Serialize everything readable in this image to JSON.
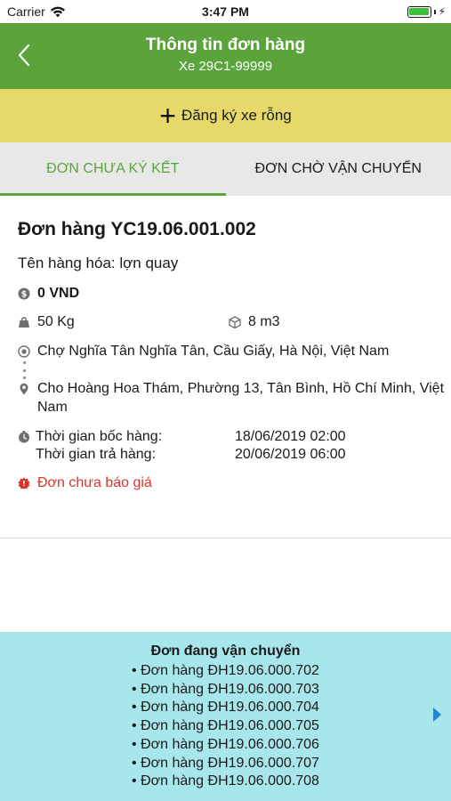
{
  "status_bar": {
    "carrier": "Carrier",
    "time": "3:47 PM"
  },
  "nav": {
    "title": "Thông tin đơn hàng",
    "subtitle": "Xe 29C1-99999"
  },
  "register": {
    "label": "Đăng ký xe rỗng"
  },
  "tabs": [
    {
      "label": "ĐƠN CHƯA KÝ KẾT",
      "active": true
    },
    {
      "label": "ĐƠN CHỜ VẬN CHUYỂN",
      "active": false
    }
  ],
  "order": {
    "title": "Đơn hàng YC19.06.001.002",
    "goods": "Tên hàng hóa: lợn quay",
    "price": "0 VND",
    "weight": "50 Kg",
    "volume": "8 m3",
    "pickup_address": "Chợ Nghĩa Tân Nghĩa Tân, Cầu Giấy, Hà Nội, Việt Nam",
    "dropoff_address": "Cho Hoàng Hoa Thám, Phường 13, Tân Bình, Hồ Chí Minh, Việt Nam",
    "pickup_time_label": "Thời gian bốc hàng:",
    "pickup_time": "18/06/2019 02:00",
    "delivery_time_label": "Thời gian trả hàng:",
    "delivery_time": "20/06/2019 06:00",
    "quote_status": "Đơn chưa báo giá"
  },
  "transit": {
    "title": "Đơn đang vận chuyển",
    "items": [
      "Đơn hàng ĐH19.06.000.702",
      "Đơn hàng ĐH19.06.000.703",
      "Đơn hàng ĐH19.06.000.704",
      "Đơn hàng ĐH19.06.000.705",
      "Đơn hàng ĐH19.06.000.706",
      "Đơn hàng ĐH19.06.000.707",
      "Đơn hàng ĐH19.06.000.708"
    ]
  },
  "colors": {
    "primary_green": "#5ba43c",
    "banner_yellow": "#e6d96a",
    "transit_cyan": "#a7e6ea",
    "alert_red": "#d9342b",
    "arrow_blue": "#1f86d6"
  },
  "icons": [
    "wifi-icon",
    "battery-icon",
    "back-chevron-icon",
    "plus-icon",
    "coin-icon",
    "weight-icon",
    "box-icon",
    "origin-pin-icon",
    "destination-pin-icon",
    "clock-icon",
    "alert-badge-icon",
    "next-arrow-icon"
  ]
}
